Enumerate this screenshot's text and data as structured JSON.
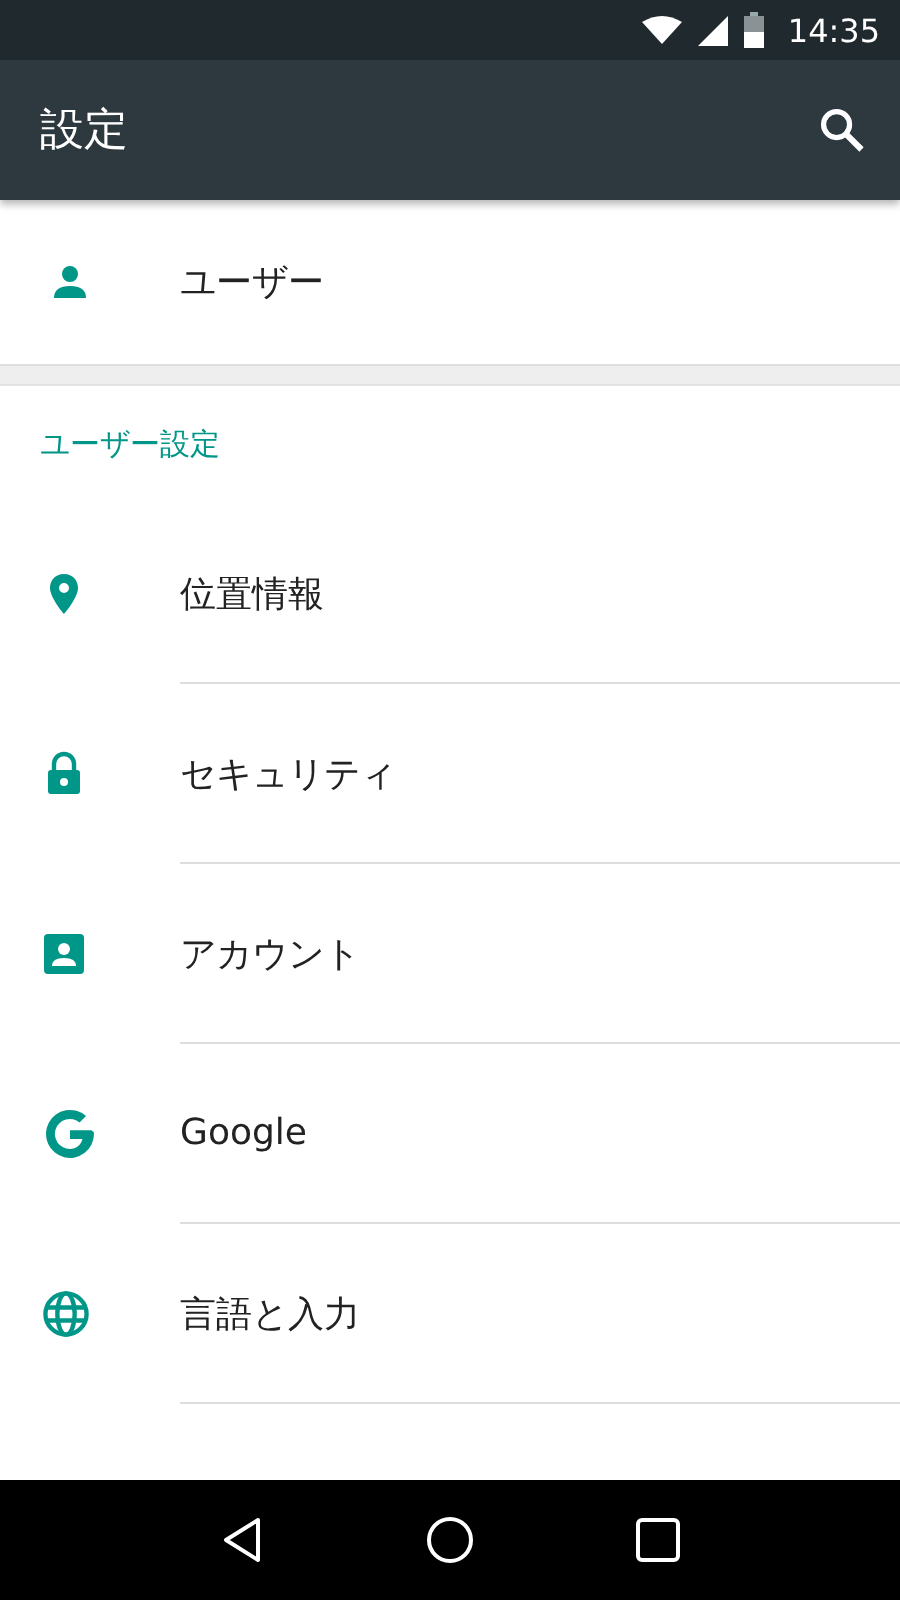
{
  "status_bar": {
    "time": "14:35"
  },
  "app_bar": {
    "title": "設定"
  },
  "user_row": {
    "label": "ユーザー"
  },
  "section": {
    "title": "ユーザー設定"
  },
  "items": [
    {
      "label": "位置情報"
    },
    {
      "label": "セキュリティ"
    },
    {
      "label": "アカウント"
    },
    {
      "label": "Google"
    },
    {
      "label": "言語と入力"
    }
  ]
}
